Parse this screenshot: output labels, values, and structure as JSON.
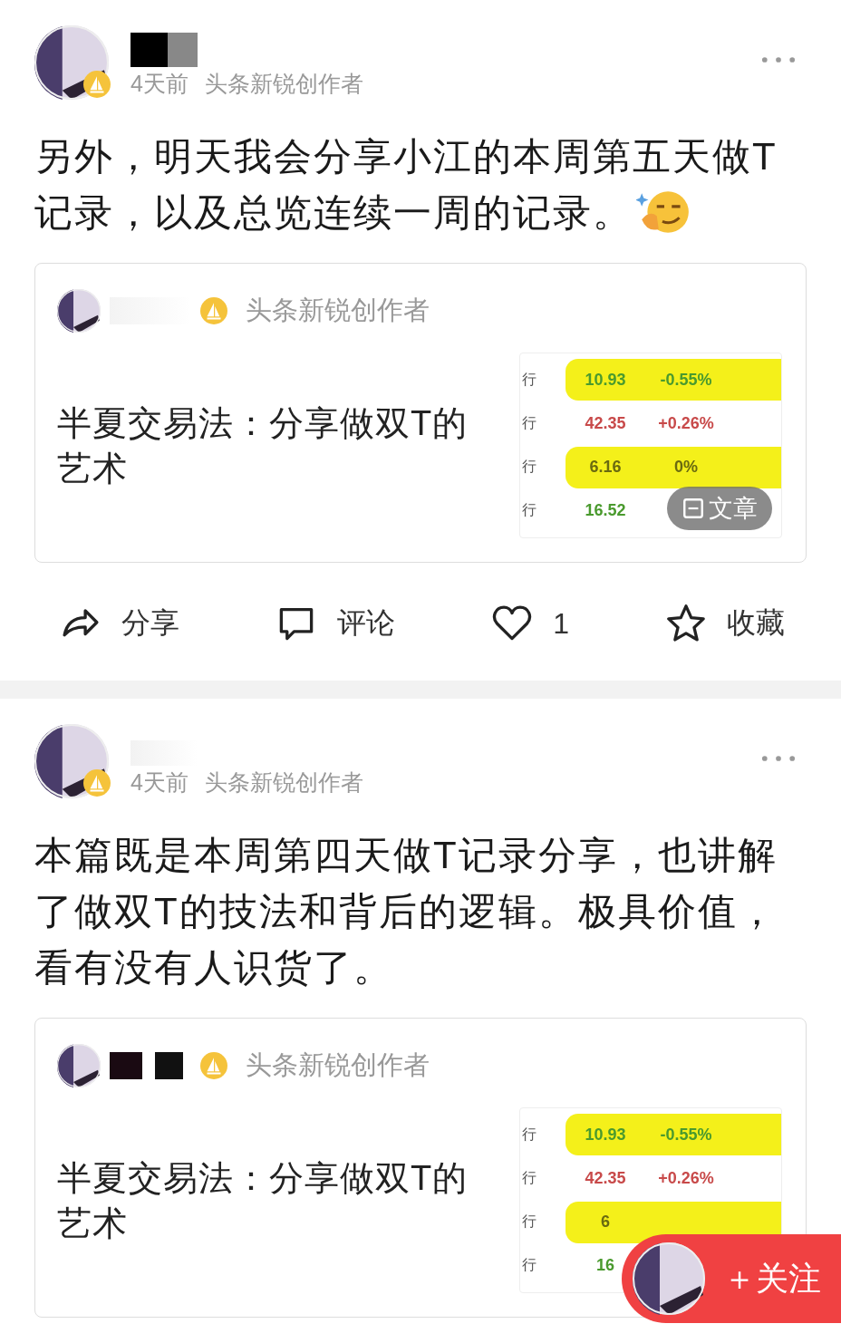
{
  "posts": [
    {
      "time": "4天前",
      "author_title": "头条新锐创作者",
      "text": "另外，明天我会分享小江的本周第五天做T记录，以及总览连续一周的记录。",
      "has_emoji": true,
      "card": {
        "author_title": "头条新锐创作者",
        "title": "半夏交易法：分享做双T的艺术",
        "thumbnail": {
          "tag": "文章",
          "rows": [
            {
              "label": "行",
              "price": "10.93",
              "change": "-0.55%",
              "color": "#4a9a2e",
              "highlighted": true
            },
            {
              "label": "行",
              "price": "42.35",
              "change": "+0.26%",
              "color": "#c84a4a",
              "highlighted": false
            },
            {
              "label": "行",
              "price": "6.16",
              "change": "0%",
              "color": "#6a6a10",
              "highlighted": true
            },
            {
              "label": "行",
              "price": "16.52",
              "color": "#4a9a2e",
              "highlighted": false
            }
          ]
        }
      },
      "actions": [
        {
          "kind": "share",
          "label": "分享"
        },
        {
          "kind": "comment",
          "label": "评论"
        },
        {
          "kind": "like",
          "label": "1"
        },
        {
          "kind": "favorite",
          "label": "收藏"
        }
      ]
    },
    {
      "time": "4天前",
      "author_title": "头条新锐创作者",
      "text": "本篇既是本周第四天做T记录分享，也讲解了做双T的技法和背后的逻辑。极具价值，看有没有人识货了。",
      "has_emoji": false,
      "card": {
        "author_title": "头条新锐创作者",
        "title": "半夏交易法：分享做双T的艺术",
        "thumbnail": {
          "rows": [
            {
              "label": "行",
              "price": "10.93",
              "change": "-0.55%",
              "color": "#4a9a2e",
              "highlighted": true
            },
            {
              "label": "行",
              "price": "42.35",
              "change": "+0.26%",
              "color": "#c84a4a",
              "highlighted": false
            },
            {
              "label": "行",
              "price": "6",
              "color": "#6a6a10",
              "highlighted": true
            },
            {
              "label": "行",
              "price": "16",
              "color": "#4a9a2e",
              "highlighted": false
            }
          ]
        }
      }
    }
  ],
  "follow_button": {
    "label": "＋关注"
  }
}
